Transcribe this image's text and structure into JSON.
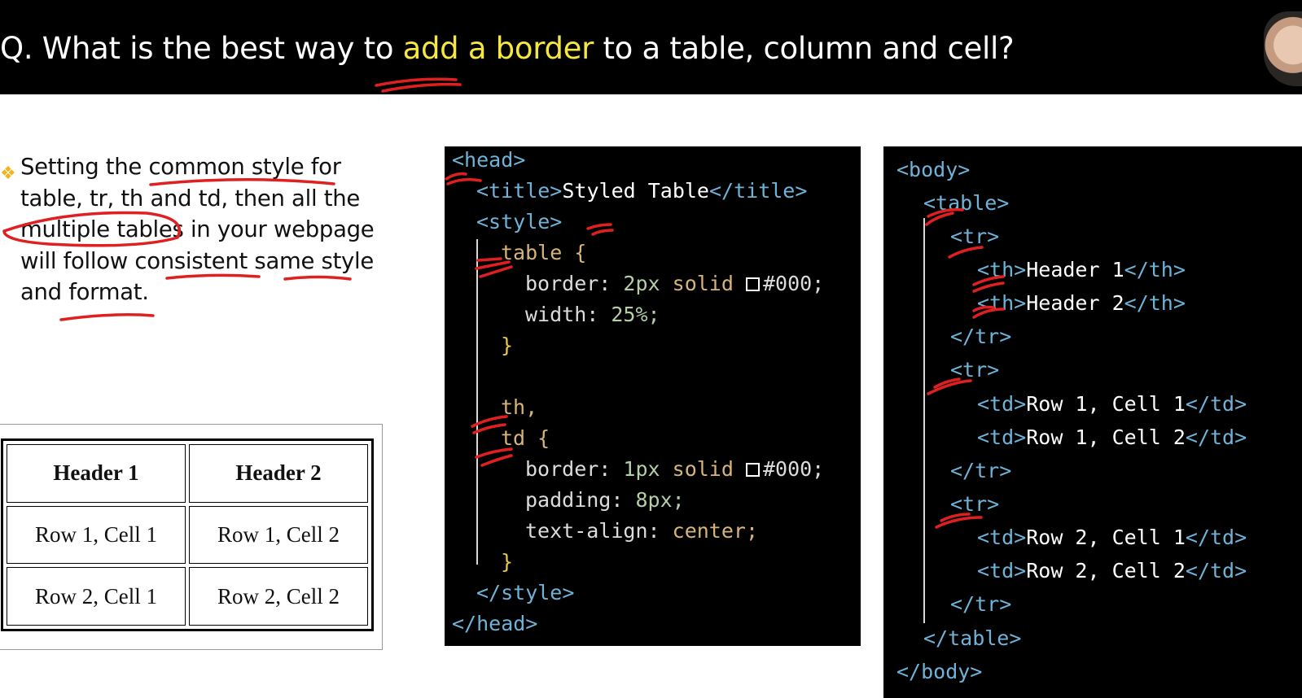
{
  "header": {
    "title_before": "Q. What is the best way to ",
    "title_highlight": "add a border",
    "title_after": " to a table, column and cell?",
    "highlight_color": "#f5e642"
  },
  "bullet": {
    "icon": "diamond-bullet-icon",
    "text": "Setting the common style for table, tr, th and td, then all the multiple tables in your webpage will follow consistent same style and format."
  },
  "demo_table": {
    "headers": [
      "Header 1",
      "Header 2"
    ],
    "rows": [
      [
        "Row 1, Cell 1",
        "Row 1, Cell 2"
      ],
      [
        "Row 2, Cell 1",
        "Row 2, Cell 2"
      ]
    ]
  },
  "head_code": {
    "head_open": "<head>",
    "title_open": "<title>",
    "title_text": "Styled Table",
    "title_close": "</title>",
    "style_open": "<style>",
    "table_sel": "table {",
    "border_prop": "border:",
    "border_val_1": "2px",
    "solid_kw": "solid",
    "color_val": "#000;",
    "width_prop": "width:",
    "width_val": "25%;",
    "brace_close": "}",
    "th_sel": "th,",
    "td_sel": "td {",
    "border_val_2": "1px",
    "padding_prop": "padding:",
    "padding_val": "8px;",
    "align_prop": "text-align:",
    "align_val": "center;",
    "style_close": "</style>",
    "head_close": "</head>"
  },
  "body_code": {
    "body_open": "<body>",
    "table_open": "<table>",
    "tr_open": "<tr>",
    "th_open": "<th>",
    "th_close": "</th>",
    "header_1": "Header 1",
    "header_2": "Header 2",
    "tr_close": "</tr>",
    "td_open": "<td>",
    "td_close": "</td>",
    "r1c1": "Row 1, Cell 1",
    "r1c2": "Row 1, Cell 2",
    "r2c1": "Row 2, Cell 1",
    "r2c2": "Row 2, Cell 2",
    "table_close": "</table>",
    "body_close": "</body>"
  },
  "colors": {
    "tag": "#6fb3d8",
    "keyword": "#d6b47a",
    "number": "#b5cea8",
    "brace": "#e8c840",
    "annotation": "#e02020"
  }
}
